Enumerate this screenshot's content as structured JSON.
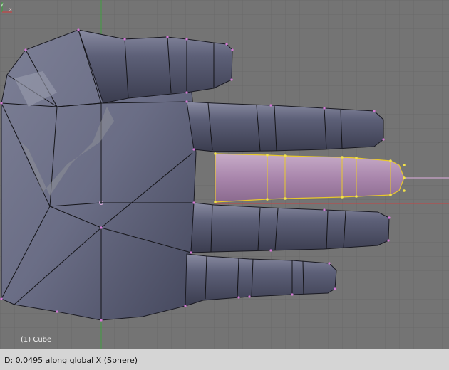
{
  "viewport": {
    "object_label": "(1) Cube",
    "background_color": "#747474",
    "grid_color": "#6a6a6a",
    "mesh_color": "#5f6279",
    "selected_face_color": "#b89cbc",
    "selected_edge_color": "#e8c82c",
    "vertex_color": "#d67ad6",
    "axis_x_color": "#c64545",
    "axis_y_color": "#3f9e3f",
    "axis_widget_icon": "axis-gizmo-icon"
  },
  "status_bar": {
    "text": "D: 0.0495 along global X (Sphere)"
  }
}
